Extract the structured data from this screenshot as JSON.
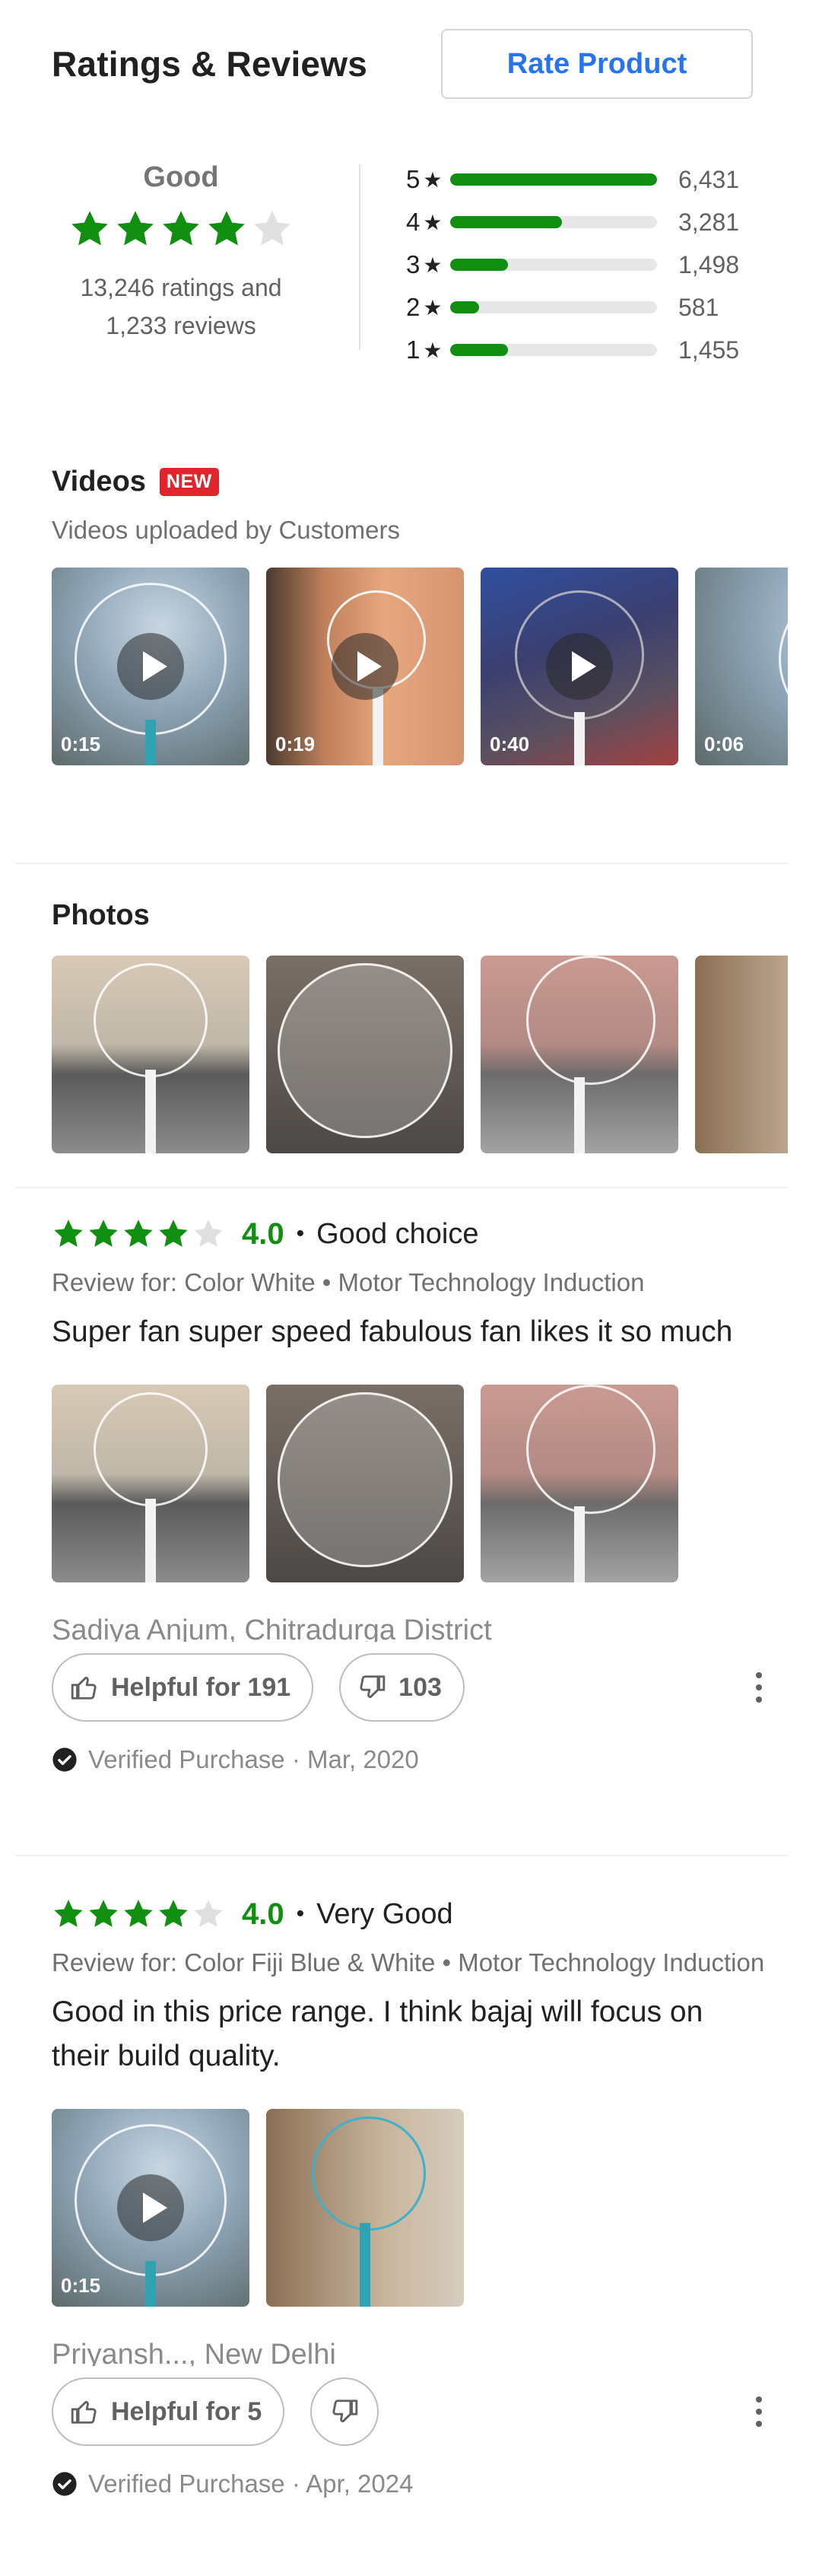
{
  "header": {
    "title": "Ratings & Reviews",
    "rate_button": "Rate Product"
  },
  "summary": {
    "label": "Good",
    "stars_filled": 4,
    "stars_total": 5,
    "ratings_line1": "13,246 ratings and",
    "ratings_line2": "1,233 reviews",
    "distribution": [
      {
        "label": "5",
        "count": "6,431",
        "fraction": 1.0
      },
      {
        "label": "4",
        "count": "3,281",
        "fraction": 0.54
      },
      {
        "label": "3",
        "count": "1,498",
        "fraction": 0.28
      },
      {
        "label": "2",
        "count": "581",
        "fraction": 0.14
      },
      {
        "label": "1",
        "count": "1,455",
        "fraction": 0.28
      }
    ]
  },
  "videos": {
    "title": "Videos",
    "badge": "NEW",
    "subtitle": "Videos uploaded by Customers",
    "items": [
      {
        "duration": "0:15"
      },
      {
        "duration": "0:19"
      },
      {
        "duration": "0:40"
      },
      {
        "duration": "0:06"
      }
    ]
  },
  "photos": {
    "title": "Photos",
    "count_visible": 4
  },
  "reviews": [
    {
      "rating": "4.0",
      "stars_filled": 4,
      "title": "Good choice",
      "review_for": "Review for: Color White • Motor Technology Induction",
      "body": "Super fan super speed fabulous fan likes it so much",
      "author": "Sadiya Anjum, Chitradurga District",
      "helpful_label": "Helpful for 191",
      "unhelpful_count": "103",
      "verified": "Verified Purchase · Mar, 2020"
    },
    {
      "rating": "4.0",
      "stars_filled": 4,
      "title": "Very Good",
      "review_for": "Review for: Color Fiji Blue & White • Motor Technology Induction",
      "body": "Good in this price range. I think bajaj will focus on their build quality.",
      "author": "Priyansh..., New Delhi",
      "helpful_label": "Helpful for 5",
      "unhelpful_count": "",
      "verified": "Verified Purchase · Apr, 2024",
      "video_duration": "0:15"
    }
  ],
  "colors": {
    "accent": "#2874f0",
    "rating_green": "#108f10",
    "badge_red": "#e0262c",
    "star_empty": "#e0e0e0"
  }
}
